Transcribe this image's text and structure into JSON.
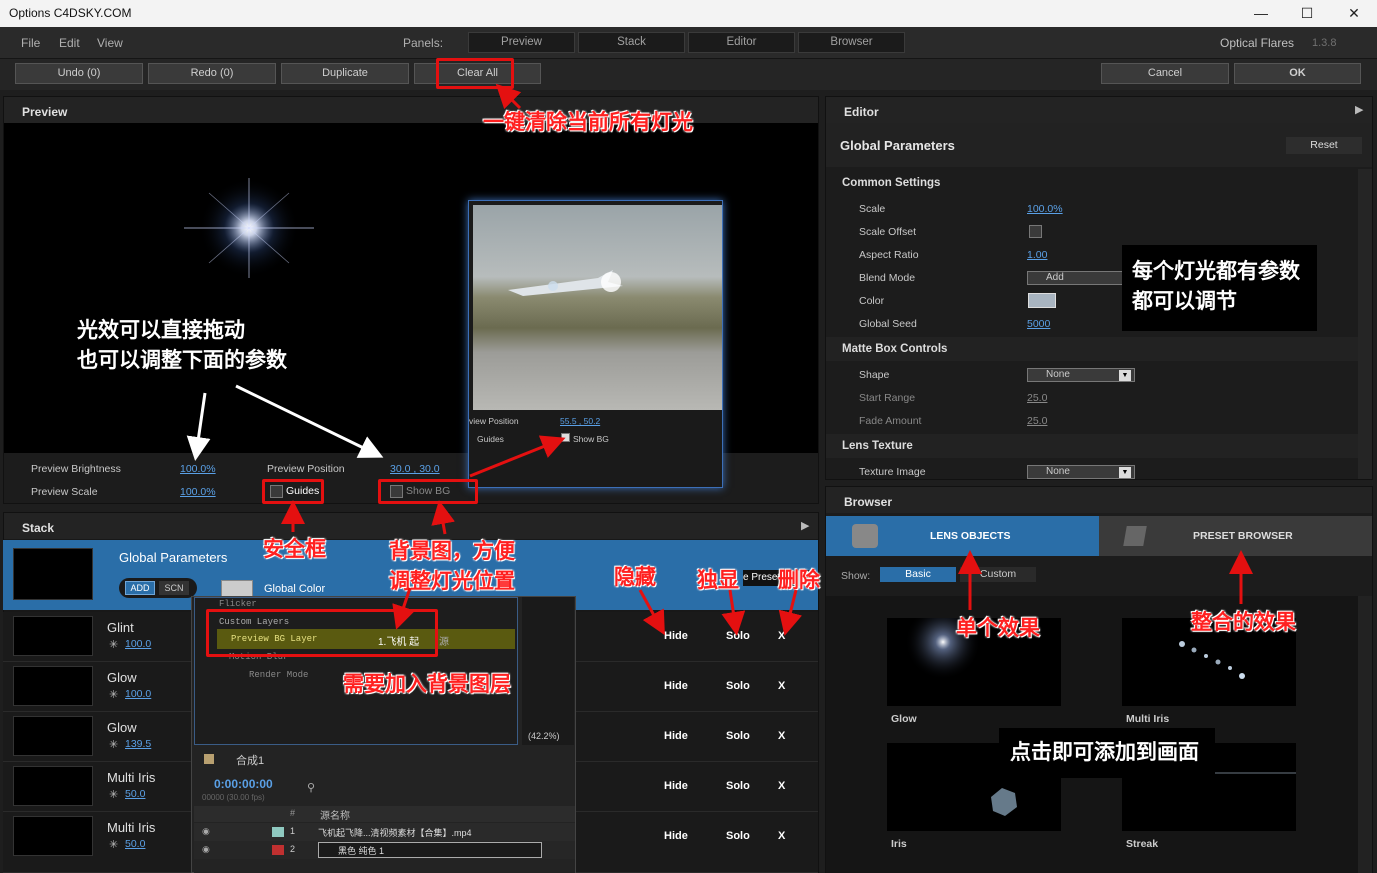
{
  "window": {
    "title": "Options C4DSKY.COM",
    "controls": [
      "—",
      "☐",
      "✕"
    ]
  },
  "menu": {
    "items": [
      "File",
      "Edit",
      "View"
    ],
    "panels_label": "Panels:",
    "panels": [
      "Preview",
      "Stack",
      "Editor",
      "Browser"
    ],
    "app": "Optical Flares",
    "version": "1.3.8"
  },
  "toolbar": {
    "undo": "Undo (0)",
    "redo": "Redo (0)",
    "duplicate": "Duplicate",
    "clear_all": "Clear All",
    "cancel": "Cancel",
    "ok": "OK"
  },
  "preview": {
    "title": "Preview",
    "brightness_label": "Preview Brightness",
    "brightness": "100.0%",
    "scale_label": "Preview Scale",
    "scale": "100.0%",
    "position_label": "Preview Position",
    "position": "30.0 , 30.0",
    "guides": "Guides",
    "show_bg": "Show BG",
    "inset": {
      "position_label": "view Position",
      "position": "55.5 , 50.2",
      "guides": "Guides",
      "show_bg": "Show BG"
    }
  },
  "editor": {
    "title": "Editor",
    "section": "Global Parameters",
    "reset": "Reset",
    "common_title": "Common Settings",
    "common": [
      {
        "label": "Scale",
        "value": "100.0%"
      },
      {
        "label": "Scale Offset",
        "value": ""
      },
      {
        "label": "Aspect Ratio",
        "value": "1.00"
      },
      {
        "label": "Blend Mode",
        "value": "Add"
      },
      {
        "label": "Color",
        "value": ""
      },
      {
        "label": "Global Seed",
        "value": "5000"
      }
    ],
    "matte_title": "Matte Box Controls",
    "matte": [
      {
        "label": "Shape",
        "value": "None"
      },
      {
        "label": "Start Range",
        "value": "25.0"
      },
      {
        "label": "Fade Amount",
        "value": "25.0"
      }
    ],
    "lens_title": "Lens Texture",
    "texture_label": "Texture Image",
    "texture_value": "None",
    "color_swatch": "#a8b4c0"
  },
  "stack": {
    "title": "Stack",
    "global": {
      "name": "Global Parameters",
      "add": "ADD",
      "scn": "SCN",
      "color_label": "Global Color",
      "preset_partial": "e Preset"
    },
    "rows": [
      {
        "name": "Glint",
        "value": "100.0",
        "hide": "Hide",
        "solo": "Solo",
        "del": "X"
      },
      {
        "name": "Glow",
        "value": "100.0",
        "hide": "Hide",
        "solo": "Solo",
        "del": "X"
      },
      {
        "name": "Glow",
        "value": "139.5",
        "hide": "Hide",
        "solo": "Solo",
        "del": "X"
      },
      {
        "name": "Multi Iris",
        "value": "50.0",
        "hide": "Hide",
        "solo": "Solo",
        "del": "X"
      },
      {
        "name": "Multi Iris",
        "value": "50.0",
        "hide": "Hide",
        "solo": "Solo",
        "del": "X"
      }
    ]
  },
  "browser": {
    "title": "Browser",
    "tab_lens": "LENS OBJECTS",
    "tab_preset": "PRESET BROWSER",
    "show_label": "Show:",
    "show_basic": "Basic",
    "show_custom": "Custom",
    "items": [
      "Glow",
      "Multi Iris",
      "Iris",
      "Streak"
    ]
  },
  "ae_overlay": {
    "props": [
      "Flicker",
      "Custom Layers",
      "Preview BG Layer",
      "Motion Blur",
      "Render Mode"
    ],
    "bg_layer_value": "1.飞机 起",
    "bg_layer_source": "源",
    "zoom": "(42.2%)",
    "comp": "合成1",
    "timecode": "0:00:00:00",
    "fps": "00000 (30.00 fps)",
    "col_hash": "#",
    "col_source": "源名称",
    "layers": [
      {
        "num": "1",
        "name": "飞机起飞降...清视频素材【合集】.mp4"
      },
      {
        "num": "2",
        "name": "黑色 纯色 1"
      }
    ]
  },
  "annotations": {
    "clear_all": "一键清除当前所有灯光",
    "drag_1": "光效可以直接拖动",
    "drag_2": "也可以调整下面的参数",
    "params_1": "每个灯光都有参数",
    "params_2": "都可以调节",
    "guides": "安全框",
    "bg_1": "背景图，方便",
    "bg_2": "调整灯光位置",
    "need_bg": "需要加入背景图层",
    "hide": "隐藏",
    "solo": "独显",
    "delete": "删除",
    "single": "单个效果",
    "combined": "整合的效果",
    "click_add": "点击即可添加到画面"
  }
}
